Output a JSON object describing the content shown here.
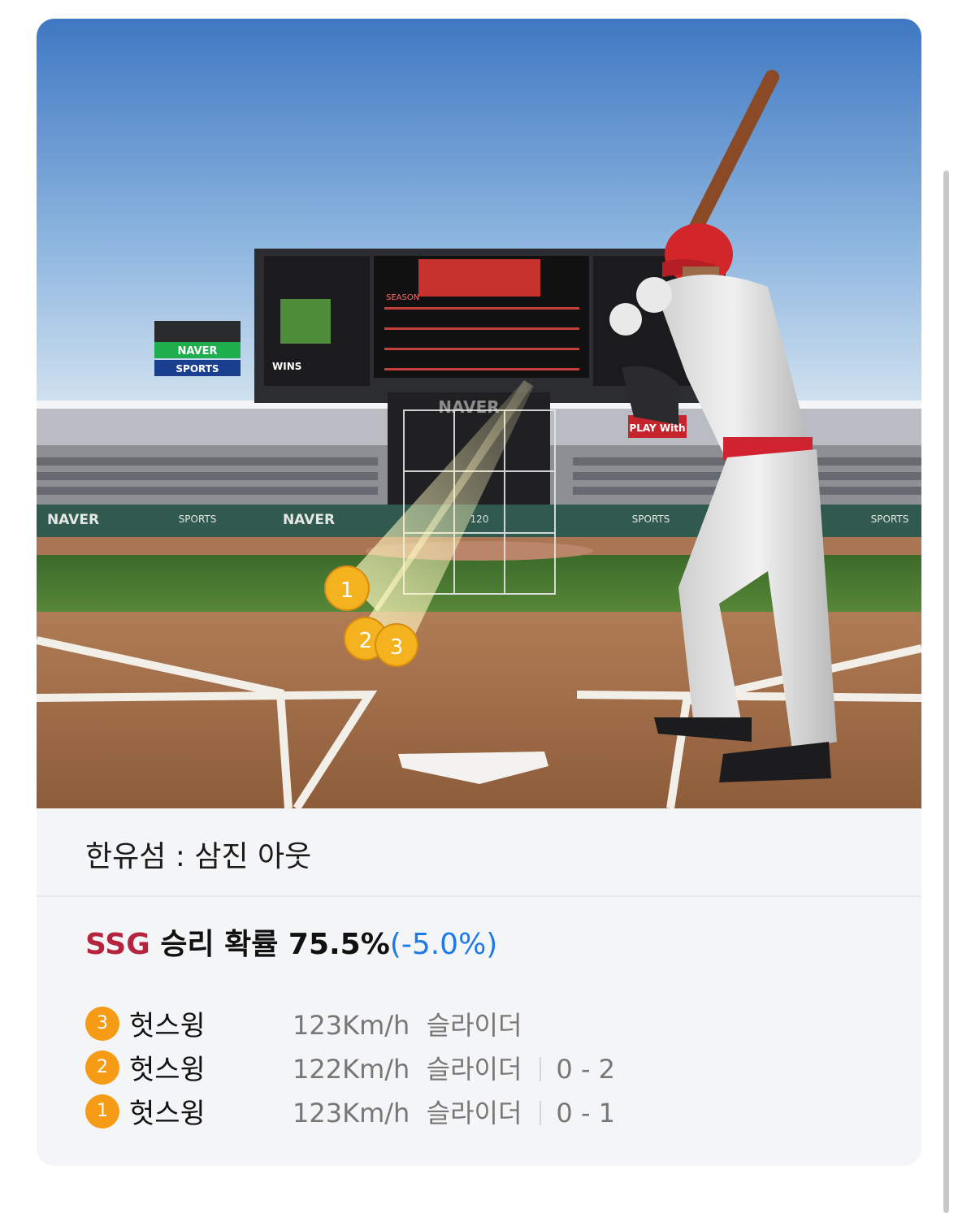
{
  "scene": {
    "scoreboard_brand": "NAVER",
    "scoreboard_labels": [
      "WINS",
      "SEASON"
    ],
    "banner_naver": "NAVER",
    "banner_sports": "SPORTS",
    "ad_play_with": "PLAY With",
    "wall_ads": [
      "NAVER",
      "SPORTS",
      "NAVER",
      "SPORTS",
      "SPORTS"
    ],
    "zone_speed": "120",
    "pitch_markers": [
      "1",
      "2",
      "3"
    ]
  },
  "result": {
    "text": "한유섬 : 삼진 아웃"
  },
  "win_probability": {
    "team": "SSG",
    "label": " 승리 확률 ",
    "value": "75.5%",
    "delta": "(-5.0%)"
  },
  "pitches": [
    {
      "num": "3",
      "result": "헛스윙",
      "speed": "123Km/h",
      "type": "슬라이더",
      "count": ""
    },
    {
      "num": "2",
      "result": "헛스윙",
      "speed": "122Km/h",
      "type": "슬라이더",
      "count": "0 - 2"
    },
    {
      "num": "1",
      "result": "헛스윙",
      "speed": "123Km/h",
      "type": "슬라이더",
      "count": "0 - 1"
    }
  ],
  "colors": {
    "team": "#b5233d",
    "delta": "#1e7be6",
    "badge": "#f59b16"
  }
}
